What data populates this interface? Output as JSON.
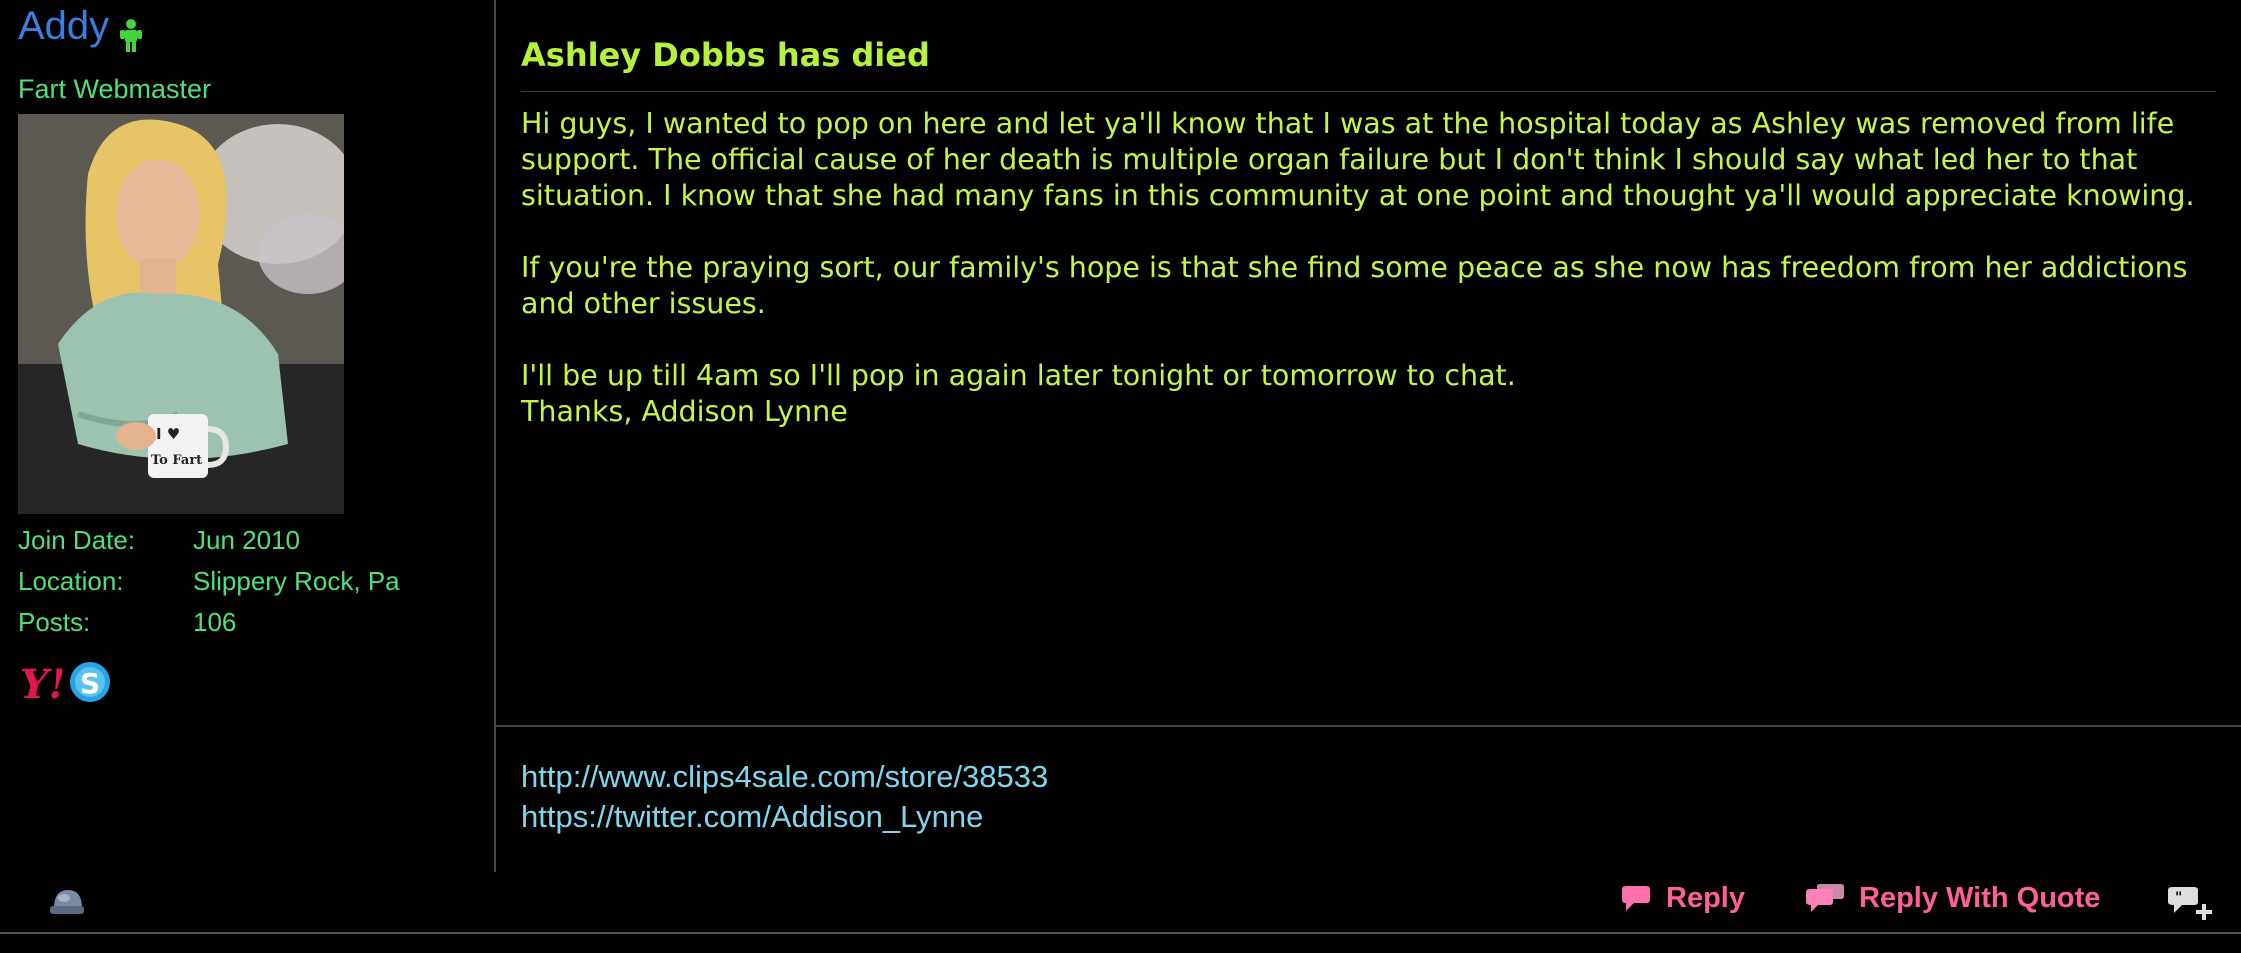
{
  "user": {
    "name": "Addy",
    "title": "Fart Webmaster",
    "stats": [
      {
        "label": "Join Date:",
        "value": "Jun 2010"
      },
      {
        "label": "Location:",
        "value": "Slippery Rock, Pa"
      },
      {
        "label": "Posts:",
        "value": "106"
      }
    ],
    "avatar_mug_text": [
      "I ♥",
      "To Fart"
    ],
    "contact_icons": [
      "yahoo-icon",
      "skype-icon"
    ],
    "colors": {
      "name": "#3d7fe0",
      "info": "#4fe07a"
    }
  },
  "post": {
    "title": "Ashley Dobbs has died",
    "paragraphs": [
      "Hi guys, I wanted to pop on here and let ya'll know that I was at the hospital today as Ashley was removed from life support. The official cause of her death is multiple organ failure but I don't think I should say what led her to that situation. I know that she had many fans in this community at one point and thought ya'll would appreciate knowing.",
      "If you're the praying sort, our family's hope is that she find some peace as she now has freedom from her addictions and other issues.",
      "I'll be up till 4am so I'll pop in again later tonight or tomorrow to chat.",
      "Thanks, Addison Lynne"
    ],
    "signature_links": [
      "http://www.clips4sale.com/store/38533",
      "https://twitter.com/Addison_Lynne"
    ],
    "colors": {
      "title": "#b6f23a",
      "text": "#c5f548",
      "links": "#7fd7ef"
    }
  },
  "footer": {
    "reply_label": "Reply",
    "reply_quote_label": "Reply With Quote",
    "icons": [
      "ip-icon",
      "reply-icon",
      "reply-quote-icon",
      "multiquote-icon"
    ],
    "colors": {
      "buttons": "#ff5f9c"
    }
  }
}
